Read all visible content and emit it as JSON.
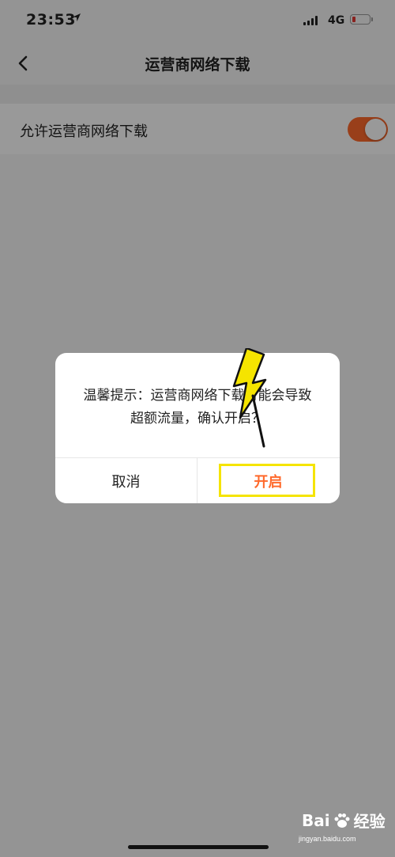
{
  "status_bar": {
    "time": "23:53",
    "network": "4G",
    "battery_level": 0.1
  },
  "nav": {
    "title": "运营商网络下载"
  },
  "settings": {
    "allow_cellular_download": {
      "label": "允许运营商网络下载",
      "enabled": true
    }
  },
  "dialog": {
    "message_line1": "温馨提示：运营商网络下载可能会导致",
    "message_line2": "超额流量，确认开启？",
    "cancel_label": "取消",
    "confirm_label": "开启"
  },
  "watermark": {
    "brand_left": "Bai",
    "brand_right": "经验",
    "url": "jingyan.baidu.com"
  },
  "colors": {
    "accent": "#ff6a2c",
    "highlight": "#f5e400"
  }
}
